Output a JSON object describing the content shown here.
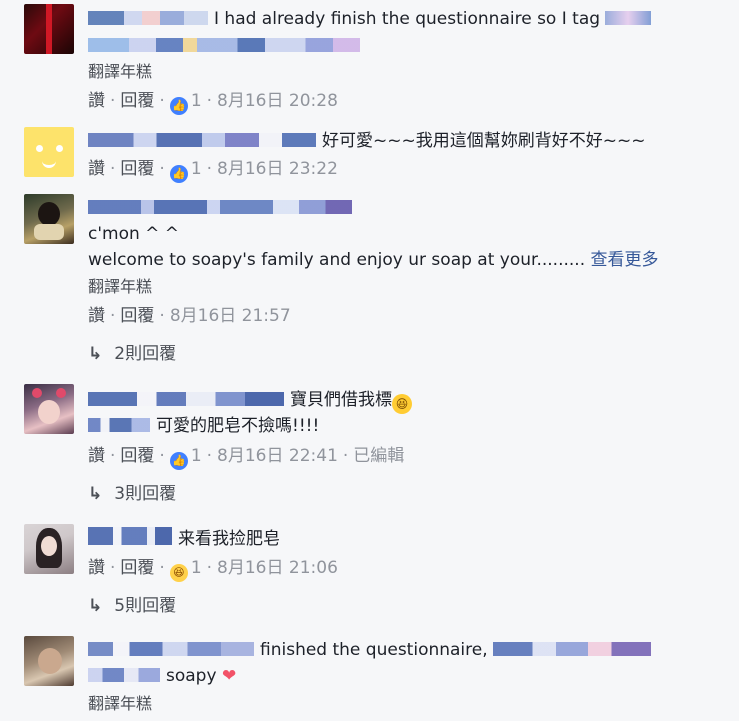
{
  "comments": [
    {
      "text": "I had already finish the questionnaire so I tag",
      "translate": "翻譯年糕",
      "like": "讚",
      "reply": "回覆",
      "reaction_count": "1",
      "time": "8月16日 20:28"
    },
    {
      "text": "好可愛~~~我用這個幫妳刷背好不好~~~",
      "like": "讚",
      "reply": "回覆",
      "reaction_count": "1",
      "time": "8月16日 23:22"
    },
    {
      "line1": "c'mon ^ ^",
      "line2": "welcome to soapy's family and enjoy ur soap at your.........",
      "see_more": "查看更多",
      "translate": "翻譯年糕",
      "like": "讚",
      "reply": "回覆",
      "time": "8月16日 21:57",
      "replies": "2則回覆"
    },
    {
      "line1": "寶貝們借我標",
      "line2": "可愛的肥皂不撿嗎!!!!",
      "like": "讚",
      "reply": "回覆",
      "reaction_count": "1",
      "time": "8月16日 22:41",
      "edited": "已編輯",
      "replies": "3則回覆"
    },
    {
      "text": "来看我捡肥皂",
      "like": "讚",
      "reply": "回覆",
      "reaction_count": "1",
      "time": "8月16日 21:06",
      "replies": "5則回覆"
    },
    {
      "line1": "finished the questionnaire,",
      "line2": "soapy",
      "translate": "翻譯年糕"
    }
  ],
  "colors": {
    "link": "#365899",
    "meta": "#90949c",
    "like_blue": "#4080ff",
    "heart": "#f25268"
  },
  "icons": [
    "like-reaction-icon",
    "haha-reaction-icon",
    "reply-arrow-icon",
    "heart-emoji-icon",
    "laughing-emoji-icon"
  ]
}
